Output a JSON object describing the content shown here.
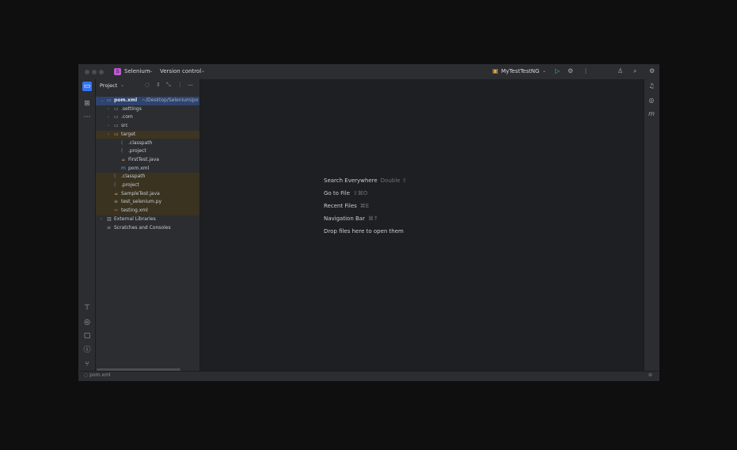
{
  "titlebar": {
    "project_badge": "S",
    "project_name": "Selenium",
    "vcs_label": "Version control",
    "run_config": "MyTestTestNG"
  },
  "panel": {
    "title": "Project",
    "tree": [
      {
        "label": "pom.xml",
        "suffix": "~/Desktop/Selenium/po",
        "indent": 0,
        "arrow": "down",
        "icon": "folder-icon",
        "state": "selected"
      },
      {
        "label": ".settings",
        "indent": 1,
        "arrow": "right",
        "icon": "folder-icon",
        "state": ""
      },
      {
        "label": ".com",
        "indent": 1,
        "arrow": "right",
        "icon": "folder-icon",
        "state": ""
      },
      {
        "label": "src",
        "indent": 1,
        "arrow": "right",
        "icon": "folder-icon",
        "state": ""
      },
      {
        "label": "target",
        "indent": 1,
        "arrow": "right",
        "icon": "folder-orange-icon",
        "state": "highlight"
      },
      {
        "label": ".classpath",
        "indent": 2,
        "arrow": "",
        "icon": "file-icon",
        "state": ""
      },
      {
        "label": ".project",
        "indent": 2,
        "arrow": "",
        "icon": "file-icon",
        "state": ""
      },
      {
        "label": "FirstTest.java",
        "indent": 2,
        "arrow": "",
        "icon": "java-file-icon",
        "state": ""
      },
      {
        "label": "pom.xml",
        "indent": 2,
        "arrow": "",
        "icon": "maven-file-icon",
        "state": ""
      },
      {
        "label": ".classpath",
        "indent": 1,
        "arrow": "",
        "icon": "file-icon",
        "state": "highlight2"
      },
      {
        "label": ".project",
        "indent": 1,
        "arrow": "",
        "icon": "file-icon",
        "state": "highlight2"
      },
      {
        "label": "SampleTest.java",
        "indent": 1,
        "arrow": "",
        "icon": "java-file-icon",
        "state": "highlight2"
      },
      {
        "label": "test_selenium.py",
        "indent": 1,
        "arrow": "",
        "icon": "python-file-icon",
        "state": "highlight2"
      },
      {
        "label": "testing.xml",
        "indent": 1,
        "arrow": "",
        "icon": "xml-file-icon",
        "state": "highlight2"
      },
      {
        "label": "External Libraries",
        "indent": 0,
        "arrow": "right",
        "icon": "library-icon",
        "state": ""
      },
      {
        "label": "Scratches and Consoles",
        "indent": 0,
        "arrow": "",
        "icon": "scratch-icon",
        "state": ""
      }
    ]
  },
  "editor": {
    "hints": [
      {
        "label": "Search Everywhere",
        "key": "Double ⇧"
      },
      {
        "label": "Go to File",
        "key": "⇧⌘O"
      },
      {
        "label": "Recent Files",
        "key": "⌘E"
      },
      {
        "label": "Navigation Bar",
        "key": "⌘↑"
      },
      {
        "label": "Drop files here to open them",
        "key": ""
      }
    ]
  },
  "statusbar": {
    "path": "pom.xml"
  },
  "colors": {
    "accent": "#3574f0",
    "project_badge": "#c157d2",
    "selection": "#2e436e",
    "excluded_highlight": "#3d3421"
  }
}
